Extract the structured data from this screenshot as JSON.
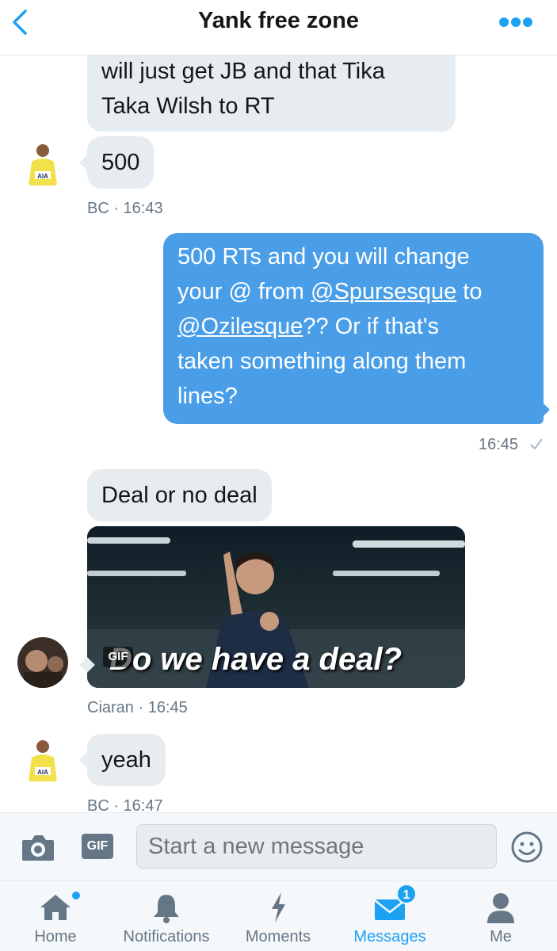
{
  "header": {
    "title": "Yank free zone",
    "back_icon": "chevron-left-icon",
    "more_icon": "ellipsis-icon"
  },
  "messages": [
    {
      "direction": "in",
      "lines": [
        "will just get JB and that Tika",
        "Taka Wilsh to RT"
      ]
    },
    {
      "direction": "in",
      "text": "500"
    },
    {
      "meta": "BC · 16:43"
    },
    {
      "direction": "out",
      "line1": "500 RTs and you will change",
      "line2_pre": "your @ from ",
      "mention1": "@Spursesque",
      "line2_post": " to",
      "mention2": "@Ozilesque",
      "line3_post": "?? Or if that's",
      "line4": "taken something along them",
      "line5": "lines?"
    },
    {
      "meta": "16:45",
      "status_icon": "checkmark-icon"
    },
    {
      "direction": "in",
      "text": "Deal or no deal"
    },
    {
      "direction": "in",
      "type": "gif",
      "badge": "GIF",
      "caption": "Do we have a deal?"
    },
    {
      "meta": "Ciaran · 16:45"
    },
    {
      "direction": "in",
      "text": "yeah"
    },
    {
      "meta": "BC · 16:47"
    }
  ],
  "composer": {
    "placeholder": "Start a new message",
    "gif_label": "GIF",
    "camera_icon": "camera-icon",
    "emoji_icon": "smiley-icon"
  },
  "tabs": [
    {
      "label": "Home",
      "icon": "home-icon",
      "has_dot": true
    },
    {
      "label": "Notifications",
      "icon": "bell-icon"
    },
    {
      "label": "Moments",
      "icon": "lightning-icon"
    },
    {
      "label": "Messages",
      "icon": "envelope-icon",
      "active": true,
      "badge": "1"
    },
    {
      "label": "Me",
      "icon": "person-icon"
    }
  ],
  "colors": {
    "accent": "#1da1f2",
    "outgoing_bubble": "#4a9ee8",
    "incoming_bubble": "#e6ecf0",
    "meta_text": "#657786"
  }
}
